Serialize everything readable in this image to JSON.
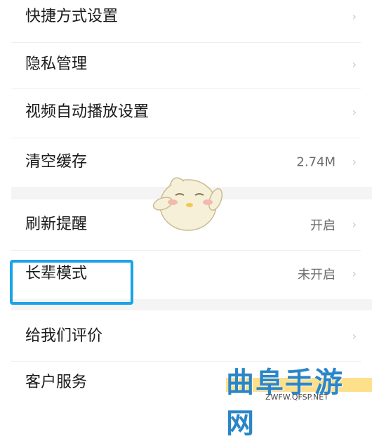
{
  "settings": {
    "items": [
      {
        "label": "快捷方式设置",
        "value": ""
      },
      {
        "label": "隐私管理",
        "value": ""
      },
      {
        "label": "视频自动播放设置",
        "value": ""
      },
      {
        "label": "清空缓存",
        "value": "2.74M"
      },
      {
        "label": "刷新提醒",
        "value": "开启"
      },
      {
        "label": "长辈模式",
        "value": "未开启"
      },
      {
        "label": "给我们评价",
        "value": ""
      },
      {
        "label": "客户服务",
        "value": ""
      }
    ],
    "chevron": "›"
  },
  "icons": {
    "chevron": "chevron-right-icon",
    "mascot": "chick-mascot-icon"
  },
  "colors": {
    "highlight": "#1aa3e8",
    "watermark": "#2a86c8",
    "section_gap": "#f4f4f4"
  },
  "watermark": {
    "brand": "曲阜手游网",
    "url": "ZWFW.QFSP.NET"
  }
}
